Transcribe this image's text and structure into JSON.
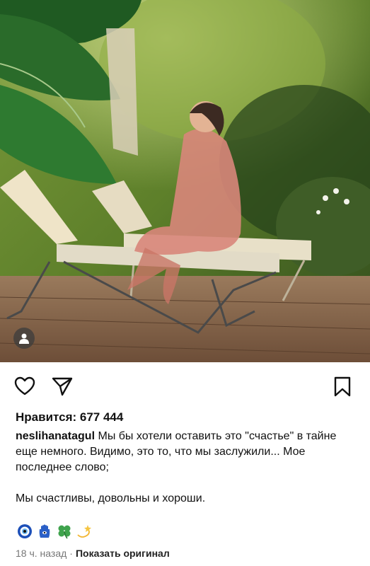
{
  "post": {
    "likes_text": "Нравится: 677 444",
    "username": "neslihanatagul",
    "caption_line1": "Мы бы хотели оставить это \"счастье\" в тайне еще немного. Видимо, это то, что мы заслужили... Мое последнее слово;",
    "caption_line2": "Мы счастливы, довольны и хороши.",
    "emoji_icons": [
      "nazar-amulet-icon",
      "hamsa-icon",
      "four-leaf-clover-icon",
      "dizzy-star-icon"
    ],
    "time_ago": "18 ч. назад",
    "separator": "·",
    "show_original": "Показать оригинал"
  },
  "colors": {
    "text": "#111111",
    "meta_gray": "#777777",
    "background": "#ffffff"
  }
}
